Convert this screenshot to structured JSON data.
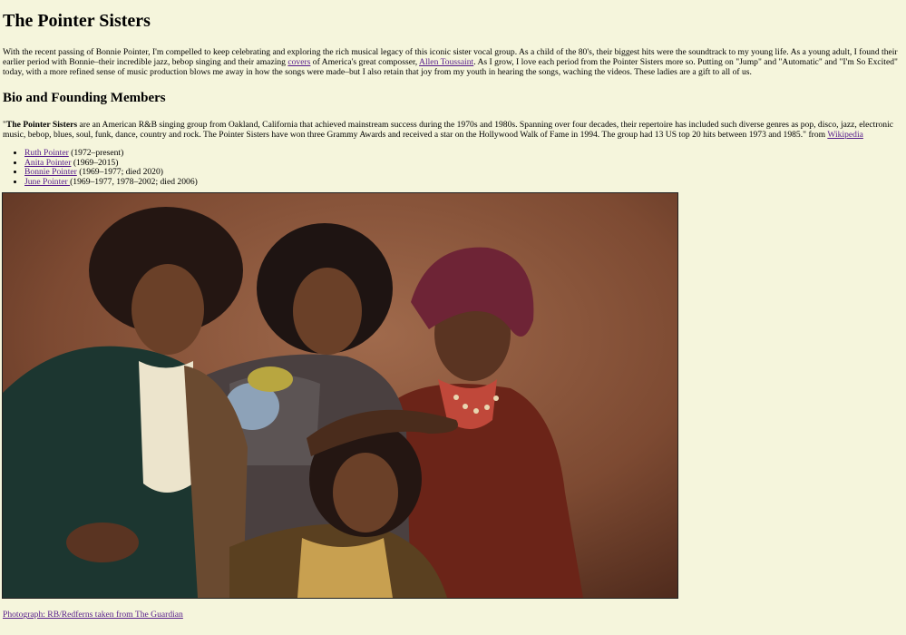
{
  "page": {
    "title": "The Pointer Sisters",
    "intro": {
      "text_1": "With the recent passing of Bonnie Pointer, I'm compelled to keep celebrating and exploring the rich musical legacy of this iconic sister vocal group. As a child of the 80's, their biggest hits were the soundtrack to my young life. As a young adult, I found their earlier period with Bonnie–their incredible jazz, bebop singing and their amazing ",
      "link_covers": "covers",
      "text_2": " of America's great composser, ",
      "link_toussaint": "Allen Toussaint",
      "text_3": ". As I grow, I love each period from the Pointer Sisters more so. Putting on \"Jump\" and \"Automatic\" and \"I'm So Excited\" today, with a more refined sense of music production blows me away in how the songs were made–but I also retain that joy from my youth in hearing the songs, waching the videos. These ladies are a gift to all of us."
    },
    "bio": {
      "heading": "Bio and Founding Members",
      "quote_open": "\"",
      "bold_name": "The Pointer Sisters",
      "text": " are an American R&B singing group from Oakland, California that achieved mainstream success during the 1970s and 1980s. Spanning over four decades, their repertoire has included such diverse genres as pop, disco, jazz, electronic music, bebop, blues, soul, funk, dance, country and rock. The Pointer Sisters have won three Grammy Awards and received a star on the Hollywood Walk of Fame in 1994. The group had 13 US top 20 hits between 1973 and 1985.\" from ",
      "link_wikipedia": "Wikipedia"
    },
    "members": [
      {
        "name": "Ruth Pointer",
        "years": " (1972–present)"
      },
      {
        "name": "Anita Pointer",
        "years": " (1969–2015)"
      },
      {
        "name": "Bonnie Pointer",
        "years": " (1969–1977; died 2020)"
      },
      {
        "name": "June Pointer ",
        "years": "(1969–1977, 1978–2002; died 2006)"
      }
    ],
    "photo_credit": "Photograph: RB/Redferns taken from The Guardian"
  },
  "colors": {
    "background": "#f5f5dc",
    "link": "#551a8b",
    "photo_backdrop": "#7a4a33"
  }
}
